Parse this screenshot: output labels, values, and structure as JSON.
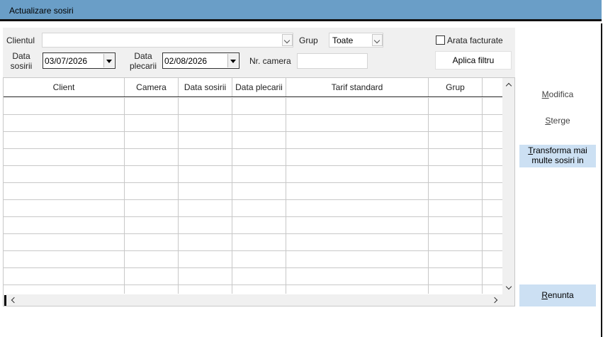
{
  "window": {
    "title": "Actualizare sosiri"
  },
  "filter": {
    "client_label": "Clientul",
    "client_value": "",
    "group_label": "Grup",
    "group_value": "Toate",
    "show_invoiced_label": "Arata facturate",
    "show_invoiced_checked": false,
    "arrival_label_line1": "Data",
    "arrival_label_line2": "sosirii",
    "arrival_value": "03/07/2026",
    "departure_label_line1": "Data",
    "departure_label_line2": "plecarii",
    "departure_value": "02/08/2026",
    "room_label": "Nr. camera",
    "room_value": "",
    "apply_button": "Aplica filtru"
  },
  "table": {
    "columns": [
      "Client",
      "Camera",
      "Data sosirii",
      "Data plecarii",
      "Tarif standard",
      "Grup",
      ""
    ],
    "rows": []
  },
  "actions": {
    "modify": {
      "accel": "M",
      "rest": "odifica"
    },
    "delete": {
      "accel": "S",
      "rest": "terge"
    },
    "transform": {
      "accel": "T",
      "rest_line1": "ransforma mai",
      "line2": "multe sosiri in"
    },
    "cancel": {
      "accel": "R",
      "rest": "enunta"
    }
  },
  "colors": {
    "titlebar": "#6a9ec7",
    "accent_button": "#cce0f3",
    "panel": "#f0f0f0"
  }
}
